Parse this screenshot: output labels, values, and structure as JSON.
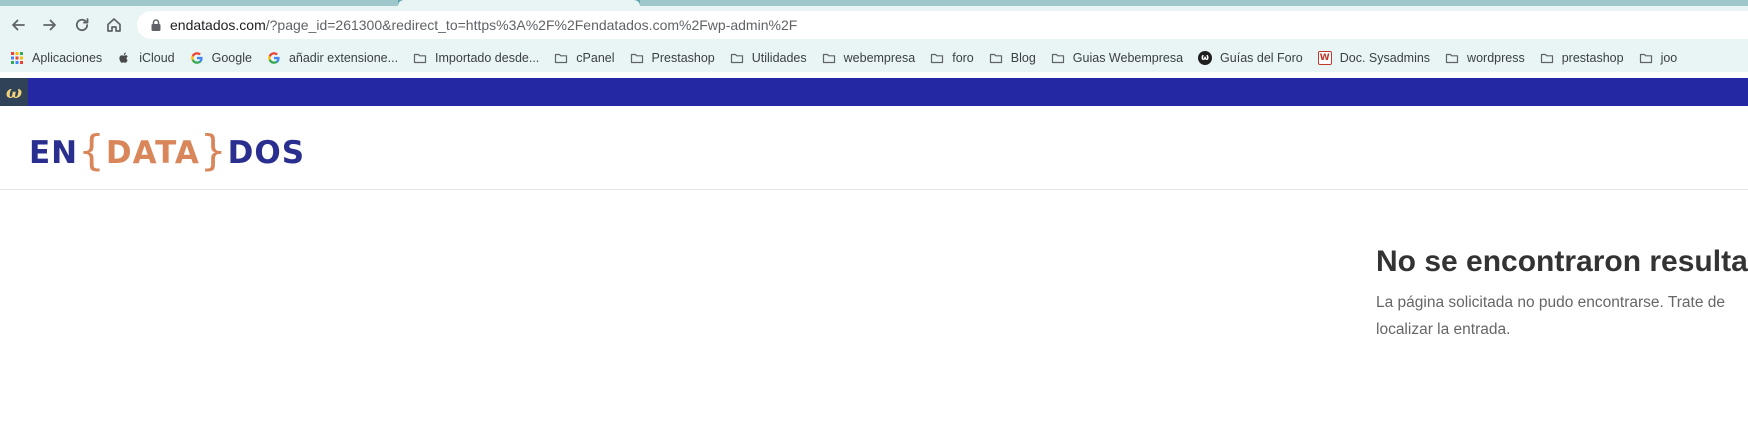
{
  "browser": {
    "url_host": "endatados.com",
    "url_path": "/?page_id=261300&redirect_to=https%3A%2F%2Fendatados.com%2Fwp-admin%2F",
    "icons": {
      "back": "arrow-left-icon",
      "forward": "arrow-right-icon",
      "reload": "reload-icon",
      "home": "home-icon",
      "lock": "lock-icon"
    }
  },
  "bookmarks": [
    {
      "label": "Aplicaciones",
      "icon": "apps-grid-icon"
    },
    {
      "label": "iCloud",
      "icon": "apple-icon"
    },
    {
      "label": "Google",
      "icon": "google-icon"
    },
    {
      "label": "añadir extensione...",
      "icon": "google-icon"
    },
    {
      "label": "Importado desde...",
      "icon": "folder-icon"
    },
    {
      "label": "cPanel",
      "icon": "folder-icon"
    },
    {
      "label": "Prestashop",
      "icon": "folder-icon"
    },
    {
      "label": "Utilidades",
      "icon": "folder-icon"
    },
    {
      "label": "webempresa",
      "icon": "folder-icon"
    },
    {
      "label": "foro",
      "icon": "folder-icon"
    },
    {
      "label": "Blog",
      "icon": "folder-icon"
    },
    {
      "label": "Guias Webempresa",
      "icon": "folder-icon"
    },
    {
      "label": "Guías del Foro",
      "icon": "webempresa-icon"
    },
    {
      "label": "Doc. Sysadmins",
      "icon": "webempresa-red-icon"
    },
    {
      "label": "wordpress",
      "icon": "folder-icon"
    },
    {
      "label": "prestashop",
      "icon": "folder-icon"
    },
    {
      "label": "joo",
      "icon": "folder-icon"
    }
  ],
  "adminbar": {
    "logo_glyph": "ω",
    "logo_icon": "webempresa-admin-icon"
  },
  "site": {
    "logo_part_a": "EN",
    "logo_brace_open": "{",
    "logo_part_b": "DATA",
    "logo_brace_close": "}",
    "logo_part_c": "DOS"
  },
  "content": {
    "title": "No se encontraron resultac",
    "line1": "La página solicitada no pudo encontrarse. Trate de",
    "line2": "localizar la entrada."
  },
  "colors": {
    "adminbar": "#2428a3",
    "logo_blue": "#2a2f8f",
    "logo_orange": "#d9875a",
    "chrome_bg": "#e9f5f5"
  }
}
